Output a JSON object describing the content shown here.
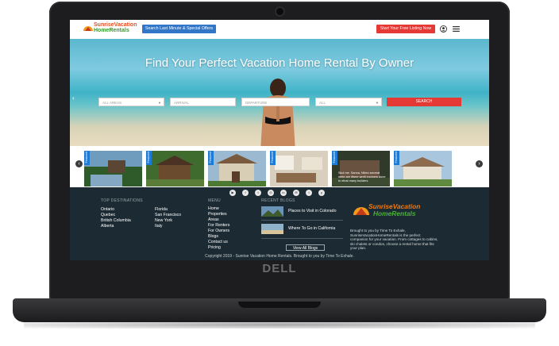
{
  "device": {
    "brand": "DELL"
  },
  "header": {
    "logo_line1": "SunriseVacation",
    "logo_line2": "HomeRentals",
    "offers_button": "Search Last Minute & Special Offers",
    "listing_button": "Start Your Free Listing Now",
    "user_icon": "user-icon",
    "menu_icon": "hamburger-menu-icon"
  },
  "hero": {
    "title": "Find Your Perfect Vacation Home Rental By Owner",
    "fields": {
      "area": "ALL AREAS",
      "arrival": "ARRIVAL",
      "departure": "DEPARTURE",
      "all": "ALL"
    },
    "search_button": "SEARCH"
  },
  "strip": {
    "ribbon_label": "Featured",
    "overlay_text": "Skol me. Sanna, Nibec secreat mete are ithere wrelt enviners done to ethat many builders"
  },
  "footer": {
    "top_destinations": {
      "title": "TOP DESTINATIONS",
      "col1": [
        "Ontario",
        "Quebec",
        "British Columbia",
        "Alberta"
      ],
      "col2": [
        "Florida",
        "San Francisco",
        "New York",
        "Italy"
      ]
    },
    "menu": {
      "title": "MENU",
      "items": [
        "Home",
        "Properties",
        "Areas",
        "For Renters",
        "For Owners",
        "Blogs",
        "Contact us",
        "Pricing"
      ]
    },
    "blogs": {
      "title": "RECENT BLOGS",
      "items": [
        "Places to Visit in Colorado",
        "Where To Go in California"
      ],
      "view_all": "View All Blogs"
    },
    "logo_line1": "SunriseVacation",
    "logo_line2": "HomeRentals",
    "about": "Brought to you by Time To Exhale, SunriseVacationHomeRentals is the perfect companion for your vacation. From cottages to cabins, ski chalets or condos, choose a rental home that fits your plan.",
    "copyright": "Copyright 2019 - Sunrise Vacation Home Rentals. Brought to you by Time To Exhale.",
    "social_icons": [
      "youtube-icon",
      "facebook-icon",
      "twitter-icon",
      "instagram-icon",
      "linkedin-icon",
      "email-icon",
      "tumblr-icon",
      "pinterest-icon"
    ]
  },
  "colors": {
    "offers_blue": "#3277c7",
    "cta_red": "#e53935",
    "footer_bg": "#1c2b33",
    "ribbon_blue": "#1d7bd6"
  }
}
